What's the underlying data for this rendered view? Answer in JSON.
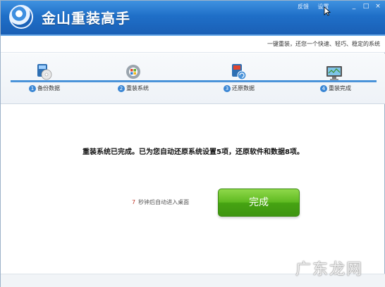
{
  "app": {
    "title": "金山重装高手"
  },
  "top_links": {
    "feedback": "反馈",
    "settings": "设置"
  },
  "window_controls": {
    "minimize": "_",
    "maximize": "□",
    "close": "×"
  },
  "slogan": "一键重装，还您一个快速、轻巧、稳定的系统",
  "steps": [
    {
      "num": "1",
      "label": "备份数据"
    },
    {
      "num": "2",
      "label": "重装系统"
    },
    {
      "num": "3",
      "label": "还原数据"
    },
    {
      "num": "4",
      "label": "重装完成"
    }
  ],
  "message": "重装系统已完成。已为您自动还原系统设置5项，还原软件和数据8项。",
  "countdown": {
    "seconds": "7",
    "text": "秒钟后自动进入桌面"
  },
  "finish_button": "完成",
  "watermark": "广东龙网",
  "colors": {
    "header": "#1f6fc8",
    "accent": "#4a93d9",
    "finish": "#5fba21"
  }
}
